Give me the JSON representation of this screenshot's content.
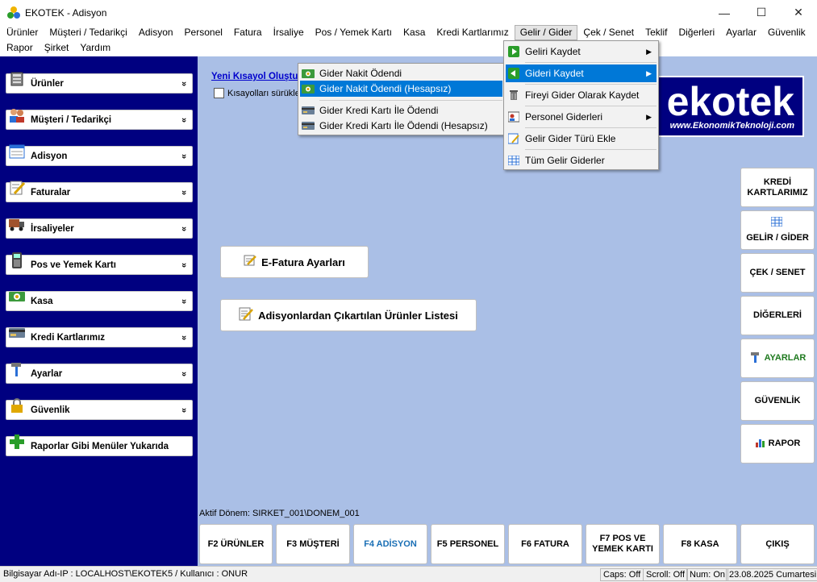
{
  "window": {
    "title": "EKOTEK - Adisyon",
    "minimize": "—",
    "maximize": "☐",
    "close": "✕"
  },
  "menubar": {
    "row1": [
      "Ürünler",
      "Müşteri / Tedarikçi",
      "Adisyon",
      "Personel",
      "Fatura",
      "İrsaliye",
      "Pos / Yemek Kartı",
      "Kasa",
      "Kredi Kartlarımız",
      "Gelir / Gider",
      "Çek / Senet",
      "Teklif",
      "Diğerleri",
      "Ayarlar",
      "Güvenlik"
    ],
    "row2": [
      "Rapor",
      "Şirket",
      "Yardım"
    ],
    "active": "Gelir / Gider"
  },
  "sidebar": {
    "items": [
      {
        "label": "Ürünler",
        "icon": "products-icon"
      },
      {
        "label": "Müşteri / Tedarikçi",
        "icon": "customers-icon"
      },
      {
        "label": "Adisyon",
        "icon": "adisyon-icon"
      },
      {
        "label": "Faturalar",
        "icon": "invoice-icon"
      },
      {
        "label": "İrsaliyeler",
        "icon": "truck-icon"
      },
      {
        "label": "Pos ve Yemek Kartı",
        "icon": "pos-icon"
      },
      {
        "label": "Kasa",
        "icon": "cash-icon"
      },
      {
        "label": "Kredi Kartlarımız",
        "icon": "credit-card-icon"
      },
      {
        "label": "Ayarlar",
        "icon": "hammer-icon"
      },
      {
        "label": "Güvenlik",
        "icon": "lock-icon"
      },
      {
        "label": "Raporlar Gibi Menüler Yukarıda",
        "icon": "plus-icon"
      }
    ],
    "chevron": "»"
  },
  "main": {
    "shortcut_link": "Yeni Kısayol Oluştu",
    "shortcut_checkbox": "Kısayolları sürükle",
    "logo_big": "ekotek",
    "logo_small": "www.EkonomikTeknoloji.com",
    "efatura_button": "E-Fatura Ayarları",
    "adisyon_button": "Adisyonlardan Çıkartılan Ürünler Listesi",
    "right_buttons": [
      "KREDİ KARTLARIMIZ",
      "GELİR / GİDER",
      "ÇEK / SENET",
      "DİĞERLERİ",
      "AYARLAR",
      "GÜVENLİK",
      "RAPOR"
    ],
    "donem": "Aktif Dönem:   SIRKET_001\\DONEM_001",
    "fkeys": [
      "F2 ÜRÜNLER",
      "F3 MÜŞTERİ",
      "F4 ADİSYON",
      "F5 PERSONEL",
      "F6 FATURA",
      "F7 POS VE YEMEK KARTI",
      "F8 KASA",
      "ÇIKIŞ"
    ]
  },
  "submenu": {
    "items": [
      "Gider Nakit Ödendi",
      "Gider Nakit Ödendi (Hesapsız)",
      "Gider Kredi Kartı İle Ödendi",
      "Gider Kredi Kartı İle Ödendi (Hesapsız)"
    ],
    "highlighted": "Gider Nakit Ödendi (Hesapsız)"
  },
  "gelir_gider_menu": {
    "items": [
      "Geliri Kaydet",
      "Gideri Kaydet",
      "Fireyi Gider Olarak Kaydet",
      "Personel Giderleri",
      "Gelir Gider Türü Ekle",
      "Tüm Gelir Giderler"
    ],
    "highlighted": "Gideri Kaydet"
  },
  "statusbar": {
    "left": "Bilgisayar Adı-IP : LOCALHOST\\EKOTEK5 / Kullanıcı : ONUR",
    "caps": "Caps: Off",
    "scroll": "Scroll: Off",
    "num": "Num: On",
    "date": "23.08.2025 Cumartesi"
  },
  "colors": {
    "sidebar": "#000080",
    "main_bg": "#aabfe6",
    "highlight": "#0078d7",
    "link": "#0000cc"
  }
}
